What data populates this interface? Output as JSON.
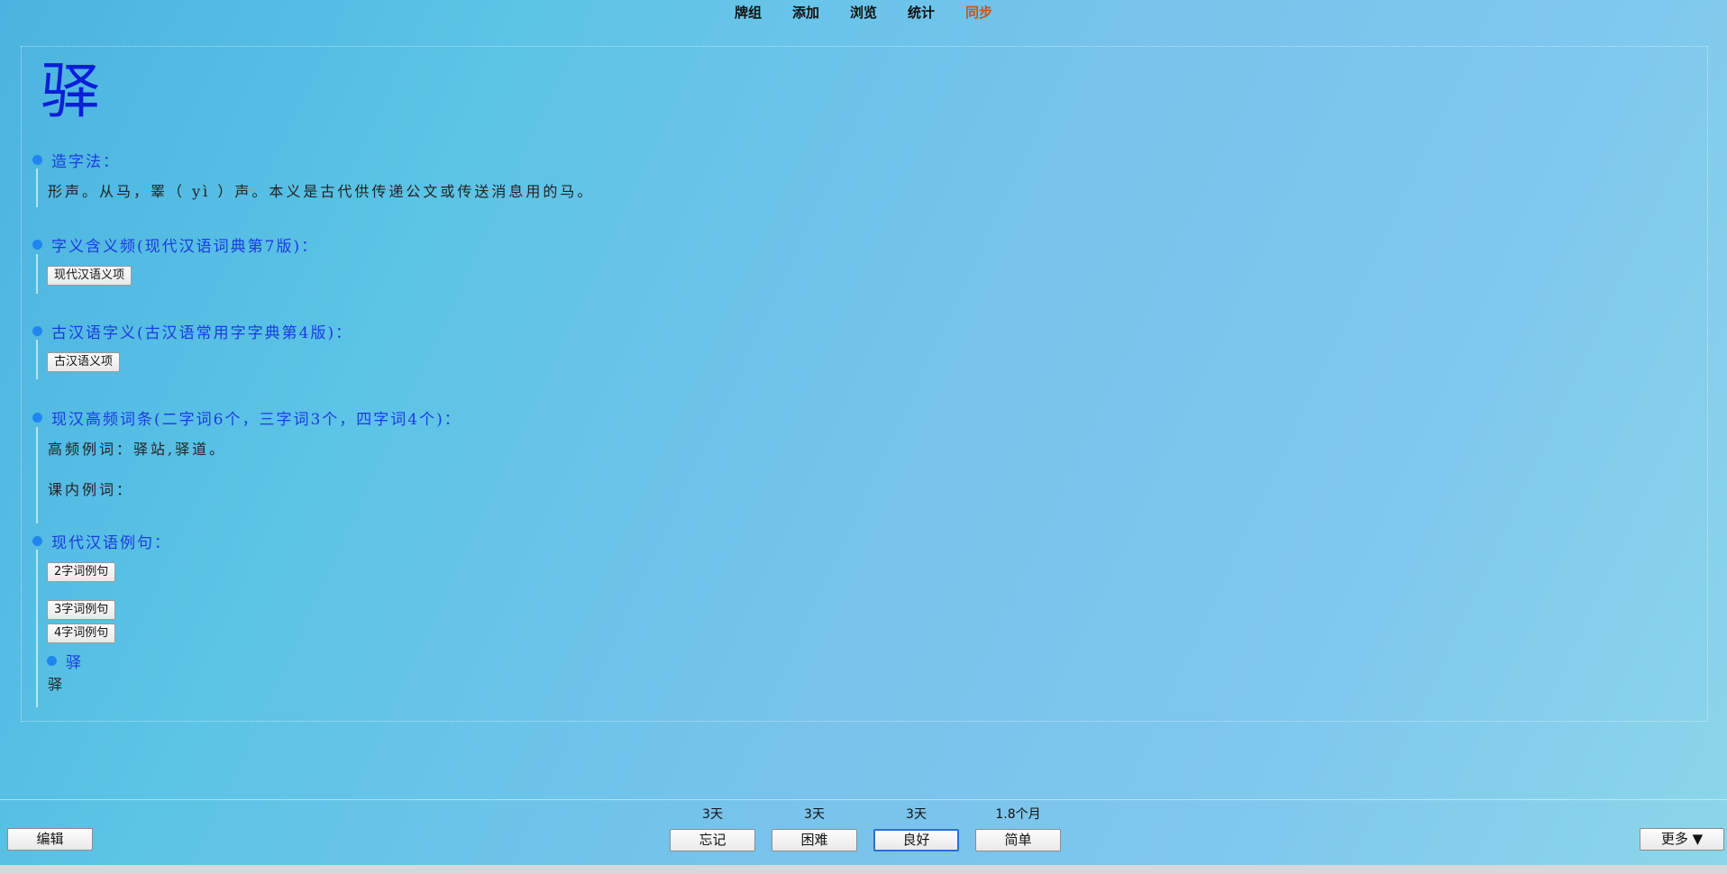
{
  "nav": {
    "items": [
      "牌组",
      "添加",
      "浏览",
      "统计",
      "同步"
    ]
  },
  "card": {
    "character": "驿",
    "sections": {
      "formation_title": "造字法：",
      "formation_text": "形声。从马，睪（ yì ）声。本义是古代供传递公文或传送消息用的马。",
      "modern_meaning_title": "字义含义频(现代汉语词典第7版)：",
      "modern_meaning_button": "现代汉语义项",
      "ancient_meaning_title": "古汉语字义(古汉语常用字字典第4版)：",
      "ancient_meaning_button": "古汉语义项",
      "words_title": "现汉高频词条(二字词6个，三字词3个，四字词4个)：",
      "high_freq_words": "高频例词：驿站,驿道。",
      "textbook_words": "课内例词：",
      "sentences_title": "现代汉语例句：",
      "btn_2char": "2字词例句",
      "btn_3char": "3字词例句",
      "btn_4char": "4字词例句",
      "sub_title": "驿",
      "sub_text": "驿"
    }
  },
  "bottom": {
    "edit_label": "编辑",
    "more_label": "更多 ▼",
    "answers": [
      {
        "interval": "3天",
        "label": "忘记"
      },
      {
        "interval": "3天",
        "label": "困难"
      },
      {
        "interval": "3天",
        "label": "良好"
      },
      {
        "interval": "1.8个月",
        "label": "简单"
      }
    ],
    "default_answer": "良好"
  }
}
